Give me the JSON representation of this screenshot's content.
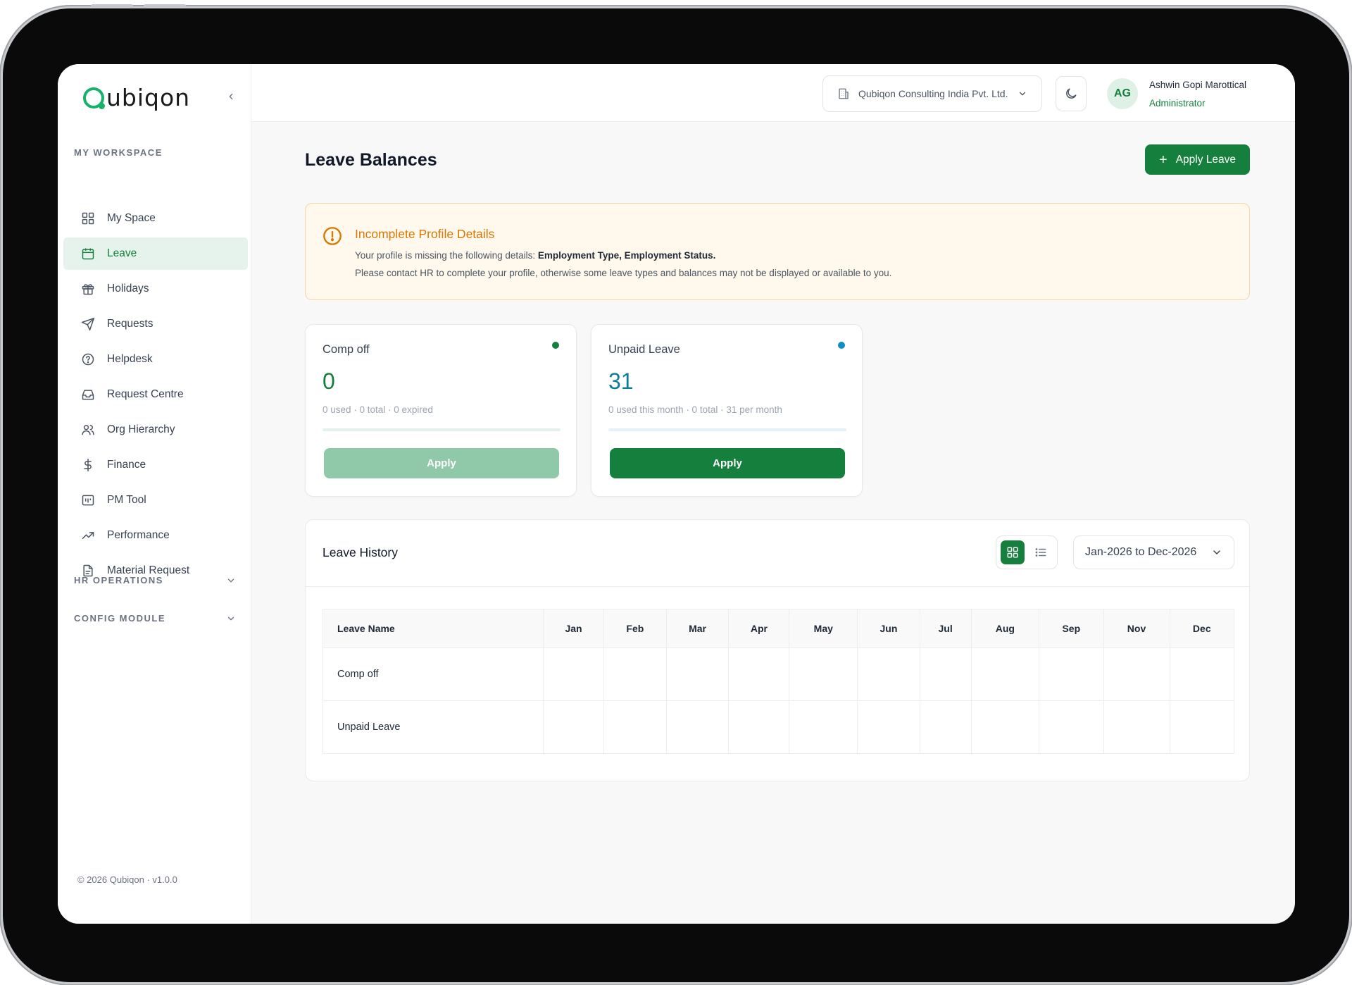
{
  "brand": {
    "logo_text": "ubiqon",
    "accent": "#15803d",
    "logo_green": "#17b26a"
  },
  "sidebar": {
    "workspace_label": "MY WORKSPACE",
    "items": [
      {
        "label": "My Space",
        "icon": "grid-icon",
        "active": false
      },
      {
        "label": "Leave",
        "icon": "calendar-icon",
        "active": true
      },
      {
        "label": "Holidays",
        "icon": "gift-icon",
        "active": false
      },
      {
        "label": "Requests",
        "icon": "send-icon",
        "active": false
      },
      {
        "label": "Helpdesk",
        "icon": "help-circle-icon",
        "active": false
      },
      {
        "label": "Request Centre",
        "icon": "inbox-icon",
        "active": false
      },
      {
        "label": "Org Hierarchy",
        "icon": "users-icon",
        "active": false
      },
      {
        "label": "Finance",
        "icon": "dollar-icon",
        "active": false
      },
      {
        "label": "PM Tool",
        "icon": "kanban-icon",
        "active": false
      },
      {
        "label": "Performance",
        "icon": "trending-up-icon",
        "active": false
      },
      {
        "label": "Material Request",
        "icon": "file-text-icon",
        "active": false
      }
    ],
    "hr_operations_label": "HR OPERATIONS",
    "config_module_label": "CONFIG MODULE",
    "copyright": "© 2026 Qubiqon · v1.0.0"
  },
  "topbar": {
    "company": "Qubiqon Consulting India Pvt. Ltd.",
    "avatar_initials": "AG",
    "user_name": "Ashwin Gopi Marottical",
    "user_role": "Administrator"
  },
  "main": {
    "title": "Leave Balances",
    "apply_leave_label": "Apply Leave",
    "alert": {
      "title": "Incomplete Profile Details",
      "line1_prefix": "Your profile is missing the following details: ",
      "line1_bold": "Employment Type, Employment Status.",
      "line2": "Please contact HR to complete your profile, otherwise some leave types and balances may not be displayed or available to you.",
      "color": "#d97706"
    },
    "cards": [
      {
        "title": "Comp off",
        "value": "0",
        "subtitle": "0 used · 0 total · 0 expired",
        "button": "Apply",
        "value_color": "#15803d",
        "dot_color": "#15803d",
        "button_enabled": false
      },
      {
        "title": "Unpaid Leave",
        "value": "31",
        "subtitle": "0 used this month · 0 total · 31 per month",
        "button": "Apply",
        "value_color": "#0e7c9c",
        "dot_color": "#0e8fbf",
        "button_enabled": true
      }
    ],
    "history": {
      "title": "Leave History",
      "range": "Jan-2026 to Dec-2026",
      "columns": [
        "Leave Name",
        "Jan",
        "Feb",
        "Mar",
        "Apr",
        "May",
        "Jun",
        "Jul",
        "Aug",
        "Sep",
        "Nov",
        "Dec"
      ],
      "rows": [
        "Comp off",
        "Unpaid Leave"
      ]
    }
  }
}
